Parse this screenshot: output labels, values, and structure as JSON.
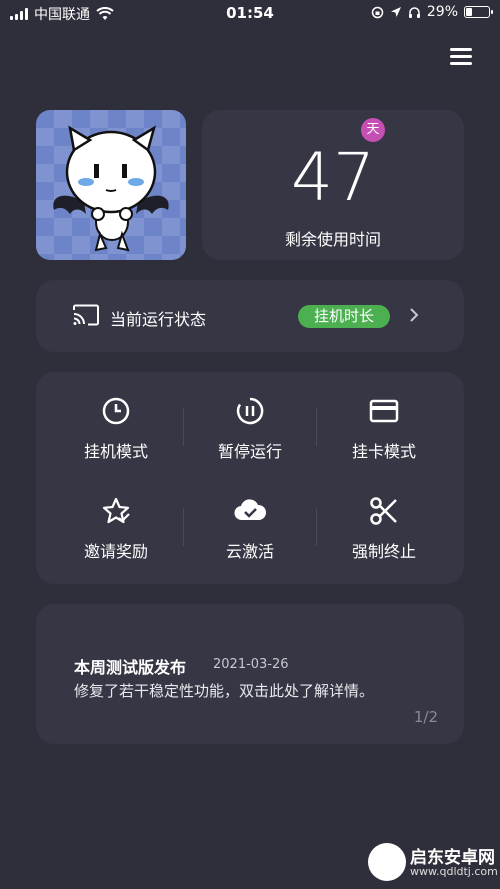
{
  "status_bar": {
    "carrier": "中国联通",
    "time": "01:54",
    "battery": "29%",
    "battery_level": 0.29
  },
  "icons": {
    "menu": "menu-icon",
    "cast": "cast-icon",
    "chevron": "chevron-right-icon",
    "wifi": "wifi-icon"
  },
  "days": {
    "badge": "天",
    "value": "47",
    "label": "剩余使用时间"
  },
  "run_status": {
    "label": "当前运行状态",
    "pill": "挂机时长"
  },
  "actions": [
    {
      "label": "挂机模式",
      "icon": "clock-icon"
    },
    {
      "label": "暂停运行",
      "icon": "pause-circle-icon"
    },
    {
      "label": "挂卡模式",
      "icon": "card-icon"
    },
    {
      "label": "邀请奖励",
      "icon": "star-check-icon"
    },
    {
      "label": "云激活",
      "icon": "cloud-check-icon"
    },
    {
      "label": "强制终止",
      "icon": "scissors-icon"
    }
  ],
  "news": {
    "title": "本周测试版发布",
    "date": "2021-03-26",
    "body": "修复了若干稳定性功能，双击此处了解详情。",
    "page": "1/2"
  },
  "watermark": {
    "name": "启东安卓网",
    "url": "www.qdldtj.com"
  },
  "colors": {
    "background": "#2f2f3b",
    "card": "#363644",
    "accent_green": "#4caf50",
    "badge_pink": "#c64fb3"
  }
}
